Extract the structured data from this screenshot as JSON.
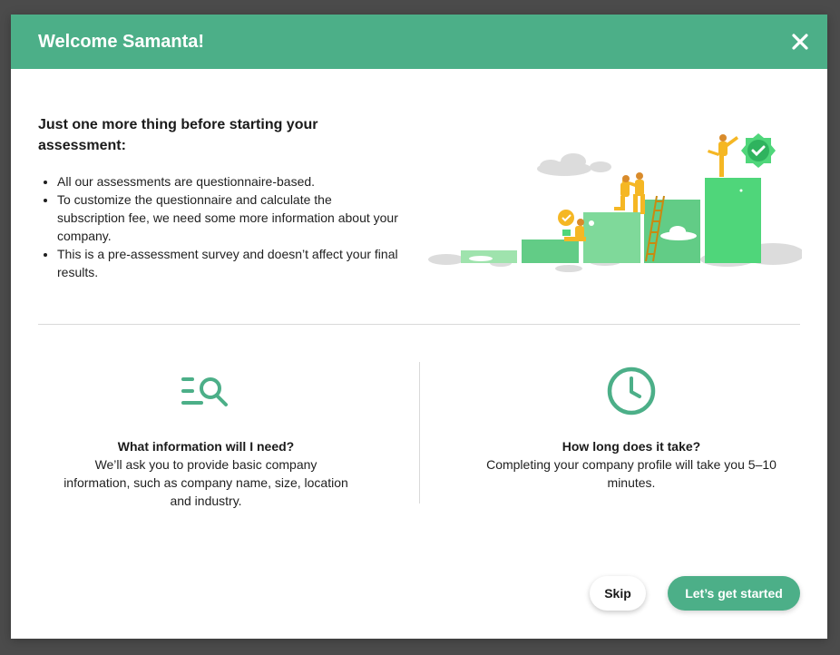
{
  "dialog": {
    "title": "Welcome Samanta!",
    "close_icon": "close-icon"
  },
  "intro": {
    "heading": "Just one more thing before starting your assessment:",
    "bullets": [
      "All our assessments are questionnaire-based.",
      "To customize the questionnaire and calculate the subscription fee, we need some more information about your company.",
      "This is a pre-assessment survey and doesn’t affect your final results."
    ]
  },
  "illustration": {
    "icon": "team-climbing-steps-illustration"
  },
  "info": [
    {
      "icon": "search-list-icon",
      "title": "What information will I need?",
      "text": "We’ll ask you to provide basic company information, such as company name, size, location and industry."
    },
    {
      "icon": "clock-icon",
      "title": "How long does it take?",
      "text": "Completing your company profile will take you 5–10 minutes."
    }
  ],
  "actions": {
    "skip_label": "Skip",
    "start_label": "Let’s get started"
  },
  "colors": {
    "accent": "#4caf88",
    "accent_bright": "#4fd67a",
    "figure": "#f5b724",
    "overlay": "#4b4b4b"
  }
}
